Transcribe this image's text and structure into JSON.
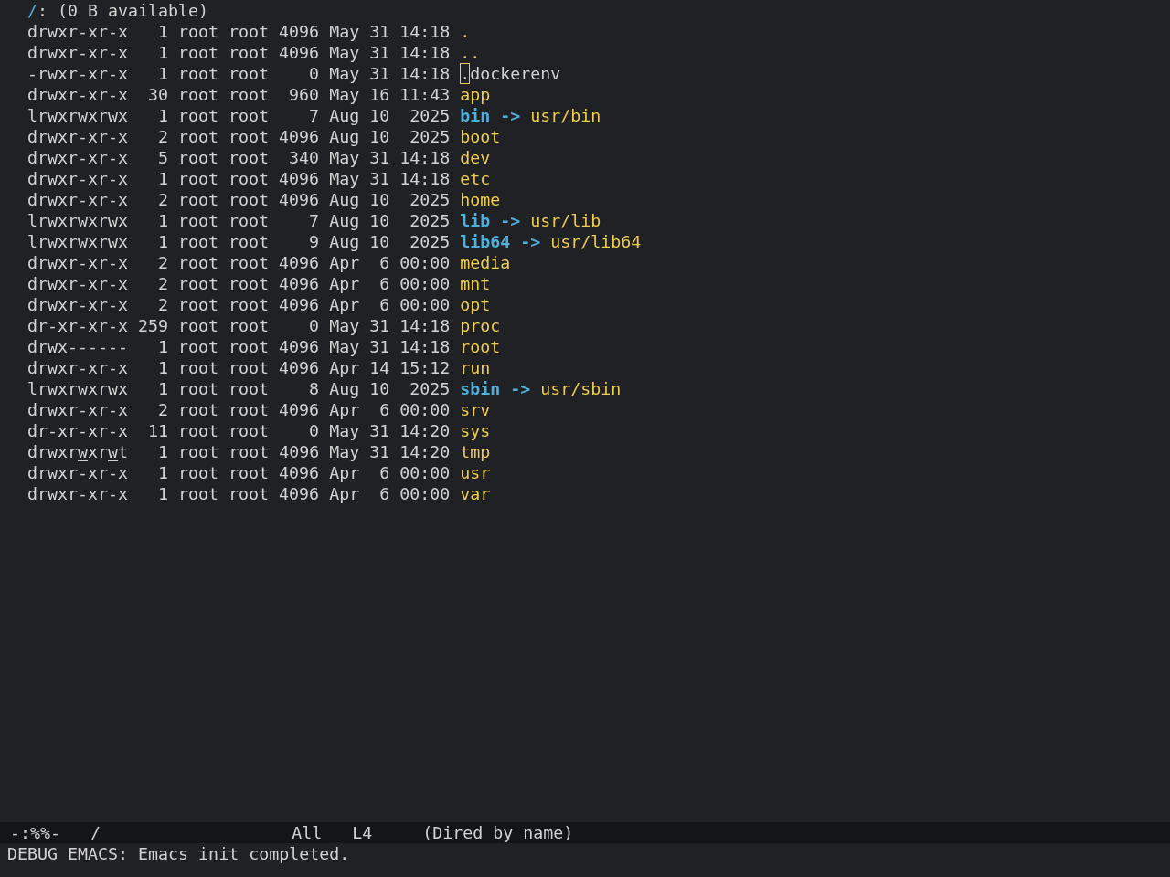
{
  "header": {
    "directory": "/",
    "info": ": (0 B available)"
  },
  "rows": [
    {
      "permissions": [
        {
          "text": "drwxr-xr-x",
          "underline": false
        }
      ],
      "links": "1",
      "owner": "root",
      "group": "root",
      "size": "4096",
      "month": "May",
      "day": "31",
      "time_or_year": "14:18",
      "kind": "dir",
      "name": ".",
      "cursor": false
    },
    {
      "permissions": [
        {
          "text": "drwxr-xr-x",
          "underline": false
        }
      ],
      "links": "1",
      "owner": "root",
      "group": "root",
      "size": "4096",
      "month": "May",
      "day": "31",
      "time_or_year": "14:18",
      "kind": "dir",
      "name": "..",
      "cursor": false
    },
    {
      "permissions": [
        {
          "text": "-rwxr-xr-x",
          "underline": false
        }
      ],
      "links": "1",
      "owner": "root",
      "group": "root",
      "size": "0",
      "month": "May",
      "day": "31",
      "time_or_year": "14:18",
      "kind": "file",
      "name": ".dockerenv",
      "cursor": true
    },
    {
      "permissions": [
        {
          "text": "drwxr-xr-x",
          "underline": false
        }
      ],
      "links": "30",
      "owner": "root",
      "group": "root",
      "size": "960",
      "month": "May",
      "day": "16",
      "time_or_year": "11:43",
      "kind": "dir",
      "name": "app",
      "cursor": false
    },
    {
      "permissions": [
        {
          "text": "lrwxrwxrwx",
          "underline": false
        }
      ],
      "links": "1",
      "owner": "root",
      "group": "root",
      "size": "7",
      "month": "Aug",
      "day": "10",
      "time_or_year": "2025",
      "kind": "symlink",
      "name": "bin",
      "arrow": "->",
      "target": "usr/bin",
      "cursor": false
    },
    {
      "permissions": [
        {
          "text": "drwxr-xr-x",
          "underline": false
        }
      ],
      "links": "2",
      "owner": "root",
      "group": "root",
      "size": "4096",
      "month": "Aug",
      "day": "10",
      "time_or_year": "2025",
      "kind": "dir",
      "name": "boot",
      "cursor": false
    },
    {
      "permissions": [
        {
          "text": "drwxr-xr-x",
          "underline": false
        }
      ],
      "links": "5",
      "owner": "root",
      "group": "root",
      "size": "340",
      "month": "May",
      "day": "31",
      "time_or_year": "14:18",
      "kind": "dir",
      "name": "dev",
      "cursor": false
    },
    {
      "permissions": [
        {
          "text": "drwxr-xr-x",
          "underline": false
        }
      ],
      "links": "1",
      "owner": "root",
      "group": "root",
      "size": "4096",
      "month": "May",
      "day": "31",
      "time_or_year": "14:18",
      "kind": "dir",
      "name": "etc",
      "cursor": false
    },
    {
      "permissions": [
        {
          "text": "drwxr-xr-x",
          "underline": false
        }
      ],
      "links": "2",
      "owner": "root",
      "group": "root",
      "size": "4096",
      "month": "Aug",
      "day": "10",
      "time_or_year": "2025",
      "kind": "dir",
      "name": "home",
      "cursor": false
    },
    {
      "permissions": [
        {
          "text": "lrwxrwxrwx",
          "underline": false
        }
      ],
      "links": "1",
      "owner": "root",
      "group": "root",
      "size": "7",
      "month": "Aug",
      "day": "10",
      "time_or_year": "2025",
      "kind": "symlink",
      "name": "lib",
      "arrow": "->",
      "target": "usr/lib",
      "cursor": false
    },
    {
      "permissions": [
        {
          "text": "lrwxrwxrwx",
          "underline": false
        }
      ],
      "links": "1",
      "owner": "root",
      "group": "root",
      "size": "9",
      "month": "Aug",
      "day": "10",
      "time_or_year": "2025",
      "kind": "symlink",
      "name": "lib64",
      "arrow": "->",
      "target": "usr/lib64",
      "cursor": false
    },
    {
      "permissions": [
        {
          "text": "drwxr-xr-x",
          "underline": false
        }
      ],
      "links": "2",
      "owner": "root",
      "group": "root",
      "size": "4096",
      "month": "Apr",
      "day": "6",
      "time_or_year": "00:00",
      "kind": "dir",
      "name": "media",
      "cursor": false
    },
    {
      "permissions": [
        {
          "text": "drwxr-xr-x",
          "underline": false
        }
      ],
      "links": "2",
      "owner": "root",
      "group": "root",
      "size": "4096",
      "month": "Apr",
      "day": "6",
      "time_or_year": "00:00",
      "kind": "dir",
      "name": "mnt",
      "cursor": false
    },
    {
      "permissions": [
        {
          "text": "drwxr-xr-x",
          "underline": false
        }
      ],
      "links": "2",
      "owner": "root",
      "group": "root",
      "size": "4096",
      "month": "Apr",
      "day": "6",
      "time_or_year": "00:00",
      "kind": "dir",
      "name": "opt",
      "cursor": false
    },
    {
      "permissions": [
        {
          "text": "dr-xr-xr-x",
          "underline": false
        }
      ],
      "links": "259",
      "owner": "root",
      "group": "root",
      "size": "0",
      "month": "May",
      "day": "31",
      "time_or_year": "14:18",
      "kind": "dir",
      "name": "proc",
      "cursor": false
    },
    {
      "permissions": [
        {
          "text": "drwx------",
          "underline": false
        }
      ],
      "links": "1",
      "owner": "root",
      "group": "root",
      "size": "4096",
      "month": "May",
      "day": "31",
      "time_or_year": "14:18",
      "kind": "dir",
      "name": "root",
      "cursor": false
    },
    {
      "permissions": [
        {
          "text": "drwxr-xr-x",
          "underline": false
        }
      ],
      "links": "1",
      "owner": "root",
      "group": "root",
      "size": "4096",
      "month": "Apr",
      "day": "14",
      "time_or_year": "15:12",
      "kind": "dir",
      "name": "run",
      "cursor": false
    },
    {
      "permissions": [
        {
          "text": "lrwxrwxrwx",
          "underline": false
        }
      ],
      "links": "1",
      "owner": "root",
      "group": "root",
      "size": "8",
      "month": "Aug",
      "day": "10",
      "time_or_year": "2025",
      "kind": "symlink",
      "name": "sbin",
      "arrow": "->",
      "target": "usr/sbin",
      "cursor": false
    },
    {
      "permissions": [
        {
          "text": "drwxr-xr-x",
          "underline": false
        }
      ],
      "links": "2",
      "owner": "root",
      "group": "root",
      "size": "4096",
      "month": "Apr",
      "day": "6",
      "time_or_year": "00:00",
      "kind": "dir",
      "name": "srv",
      "cursor": false
    },
    {
      "permissions": [
        {
          "text": "dr-xr-xr-x",
          "underline": false
        }
      ],
      "links": "11",
      "owner": "root",
      "group": "root",
      "size": "0",
      "month": "May",
      "day": "31",
      "time_or_year": "14:20",
      "kind": "dir",
      "name": "sys",
      "cursor": false
    },
    {
      "permissions": [
        {
          "text": "drwxr",
          "underline": false
        },
        {
          "text": "w",
          "underline": true
        },
        {
          "text": "xr",
          "underline": false
        },
        {
          "text": "w",
          "underline": true
        },
        {
          "text": "t",
          "underline": false
        }
      ],
      "links": "1",
      "owner": "root",
      "group": "root",
      "size": "4096",
      "month": "May",
      "day": "31",
      "time_or_year": "14:20",
      "kind": "dir",
      "name": "tmp",
      "cursor": false
    },
    {
      "permissions": [
        {
          "text": "drwxr-xr-x",
          "underline": false
        }
      ],
      "links": "1",
      "owner": "root",
      "group": "root",
      "size": "4096",
      "month": "Apr",
      "day": "6",
      "time_or_year": "00:00",
      "kind": "dir",
      "name": "usr",
      "cursor": false
    },
    {
      "permissions": [
        {
          "text": "drwxr-xr-x",
          "underline": false
        }
      ],
      "links": "1",
      "owner": "root",
      "group": "root",
      "size": "4096",
      "month": "Apr",
      "day": "6",
      "time_or_year": "00:00",
      "kind": "dir",
      "name": "var",
      "cursor": false
    }
  ],
  "mode_line": {
    "status": "-:%%-",
    "buffer_name": "/",
    "position": "All",
    "line": "L4",
    "mode": "(Dired by name)"
  },
  "echo_area": {
    "message": "DEBUG EMACS: Emacs init completed."
  }
}
